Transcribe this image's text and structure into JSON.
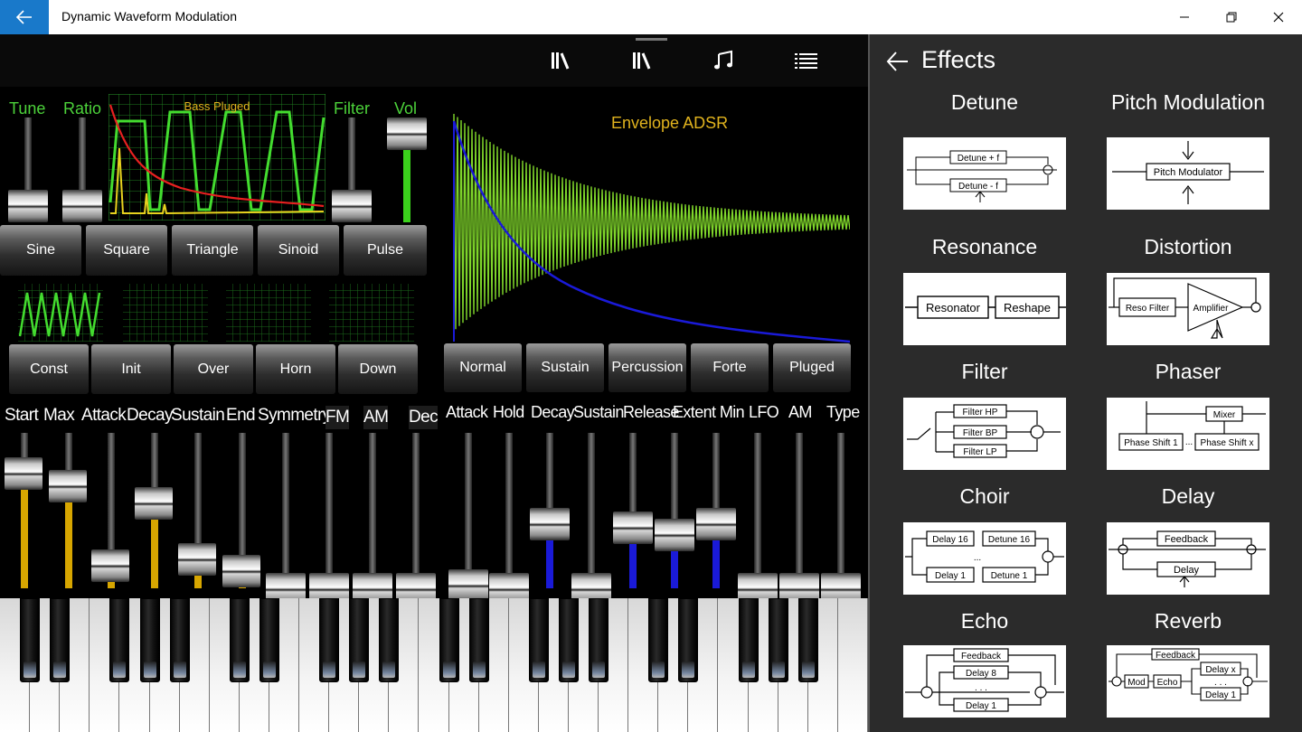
{
  "app": {
    "title": "Dynamic Waveform Modulation"
  },
  "oscillator": {
    "labels": [
      "Tune",
      "Ratio",
      "Filter",
      "Vol"
    ],
    "scope_title": "Bass Pluged",
    "waveforms": [
      "Sine",
      "Square",
      "Triangle",
      "Sinoid",
      "Pulse"
    ],
    "modes": [
      "Const",
      "Init",
      "Over",
      "Horn",
      "Down"
    ],
    "slider_labels": [
      "Start",
      "Max",
      "Attack",
      "Decay",
      "Sustain",
      "End",
      "Symmetry",
      "FM",
      "AM",
      "Dec"
    ]
  },
  "envelope": {
    "title": "Envelope ADSR",
    "presets": [
      "Normal",
      "Sustain",
      "Percussion",
      "Forte",
      "Pluged"
    ],
    "slider_labels": [
      "Attack",
      "Hold",
      "Decay",
      "Sustain",
      "Release",
      "Extent Min",
      "LFO",
      "AM",
      "Type"
    ]
  },
  "effects": {
    "title": "Effects",
    "items": [
      {
        "name": "Detune",
        "diagram": [
          "Detune + f",
          "Detune - f"
        ]
      },
      {
        "name": "Pitch Modulation",
        "diagram": [
          "Pitch Modulator"
        ]
      },
      {
        "name": "Resonance",
        "diagram": [
          "Resonator",
          "Reshape"
        ]
      },
      {
        "name": "Distortion",
        "diagram": [
          "Reso Filter",
          "Amplifier"
        ]
      },
      {
        "name": "Filter",
        "diagram": [
          "Filter HP",
          "Filter BP",
          "Filter LP"
        ]
      },
      {
        "name": "Phaser",
        "diagram": [
          "Mixer",
          "Phase Shift 1",
          "Phase Shift x"
        ]
      },
      {
        "name": "Choir",
        "diagram": [
          "Delay 16",
          "Detune 16",
          "Delay 1",
          "Detune 1"
        ]
      },
      {
        "name": "Delay",
        "diagram": [
          "Feedback",
          "Delay"
        ]
      },
      {
        "name": "Echo",
        "diagram": [
          "Feedback",
          "Delay 8",
          "Delay 1"
        ]
      },
      {
        "name": "Reverb",
        "diagram": [
          "Feedback",
          "Mod",
          "Echo",
          "Delay x",
          "Delay 1"
        ]
      }
    ]
  },
  "colors": {
    "accent": "#1979ca",
    "green": "#4cd23a",
    "yellow": "#e1b31e",
    "blue": "#1a1ad8"
  }
}
